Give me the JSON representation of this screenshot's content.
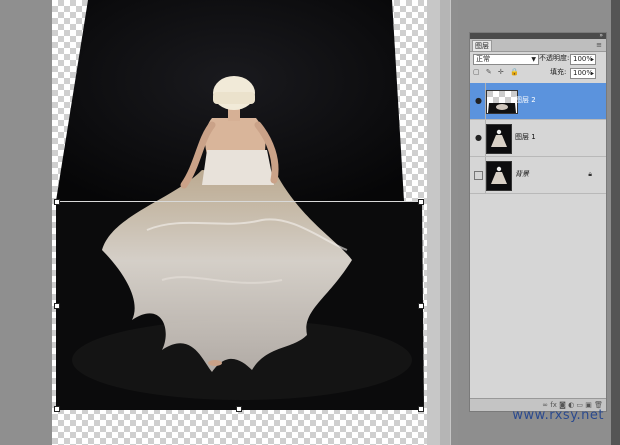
{
  "watermark": "www.rxsy.net",
  "layers_panel": {
    "tab_label": "图层",
    "menu_icon": "panel-menu-icon",
    "blend_mode": "正常",
    "opacity_label": "不透明度:",
    "opacity_value": "100%",
    "fill_label": "填充:",
    "fill_value": "100%",
    "lock_icons": "▢ ✎ ✛ 🔒",
    "layers": [
      {
        "name": "图层 2",
        "visible": true,
        "selected": true
      },
      {
        "name": "图层 1",
        "visible": true,
        "selected": false
      },
      {
        "name": "背景",
        "visible": false,
        "selected": false,
        "locked": true
      }
    ],
    "footer_icons": "∞ fx ◙ ◐ ▭ ▣ 🗑"
  },
  "colors": {
    "selection": "#5b93dd",
    "canvas_bg": "#8f8f8f",
    "photo_dark": "#0c0c0e"
  }
}
